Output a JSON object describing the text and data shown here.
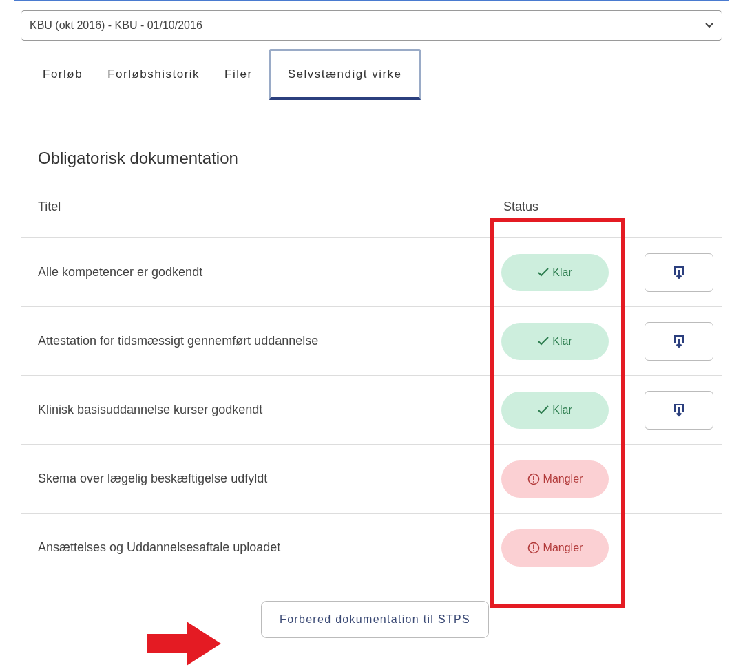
{
  "course_select": {
    "value": "KBU (okt 2016) - KBU - 01/10/2016"
  },
  "tabs": [
    {
      "label": "Forløb",
      "selected": false
    },
    {
      "label": "Forløbshistorik",
      "selected": false
    },
    {
      "label": "Filer",
      "selected": false
    },
    {
      "label": "Selvstændigt virke",
      "selected": true
    }
  ],
  "section_title": "Obligatorisk dokumentation",
  "table": {
    "columns": [
      "Titel",
      "Status"
    ],
    "rows": [
      {
        "title": "Alle kompetencer er godkendt",
        "status": {
          "kind": "ready",
          "label": "Klar"
        },
        "downloadable": true
      },
      {
        "title": "Attestation for tidsmæssigt gennemført uddannelse",
        "status": {
          "kind": "ready",
          "label": "Klar"
        },
        "downloadable": true
      },
      {
        "title": "Klinisk basisuddannelse kurser godkendt",
        "status": {
          "kind": "ready",
          "label": "Klar"
        },
        "downloadable": true
      },
      {
        "title": "Skema over lægelig beskæftigelse udfyldt",
        "status": {
          "kind": "missing",
          "label": "Mangler"
        },
        "downloadable": false
      },
      {
        "title": "Ansættelses og Uddannelsesaftale uploadet",
        "status": {
          "kind": "missing",
          "label": "Mangler"
        },
        "downloadable": false
      }
    ]
  },
  "prepare_button": "Forbered dokumentation til STPS"
}
